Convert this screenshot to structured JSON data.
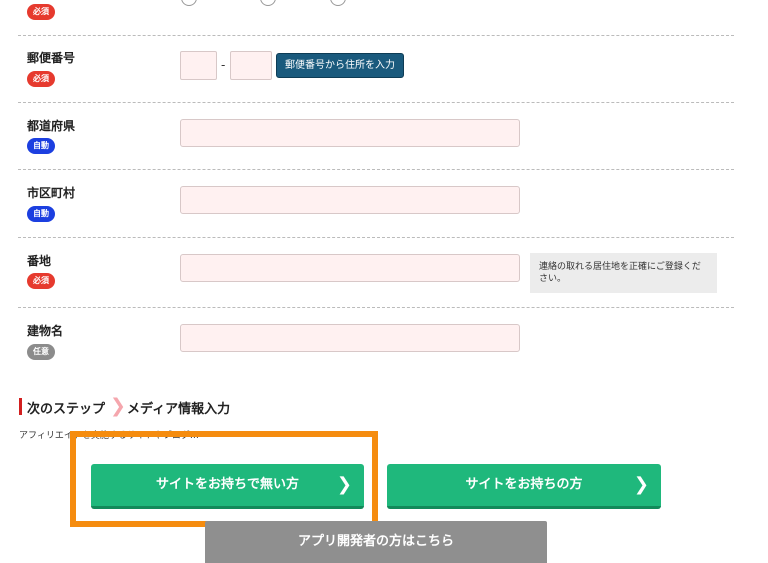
{
  "gender_row": {
    "badge": "必須"
  },
  "postal": {
    "label": "郵便番号",
    "badge": "必須",
    "dash": "-",
    "lookup_button": "郵便番号から住所を入力"
  },
  "prefecture": {
    "label": "都道府県",
    "badge": "自動",
    "value": ""
  },
  "city": {
    "label": "市区町村",
    "badge": "自動",
    "value": ""
  },
  "street": {
    "label": "番地",
    "badge": "必須",
    "value": "",
    "note": "連絡の取れる居住地を正確にご登録ください。"
  },
  "building": {
    "label": "建物名",
    "badge": "任意",
    "value": ""
  },
  "next_step": {
    "label": "次のステップ",
    "chevron": "❯",
    "target": "メディア情報入力"
  },
  "affiliate_note": "アフィリエイトを実施するサイトやブログ…",
  "buttons": {
    "no_site": "サイトをお持ちで無い方",
    "has_site": "サイトをお持ちの方",
    "app_developer": "アプリ開発者の方はこちら",
    "chevron": "❯"
  },
  "colors": {
    "required_badge": "#e63a2e",
    "auto_badge": "#1c3fe0",
    "optional_badge": "#8c8c8c",
    "primary_green": "#1fb87c",
    "highlight_orange": "#f58c0f",
    "input_fill": "#fff1f1"
  }
}
